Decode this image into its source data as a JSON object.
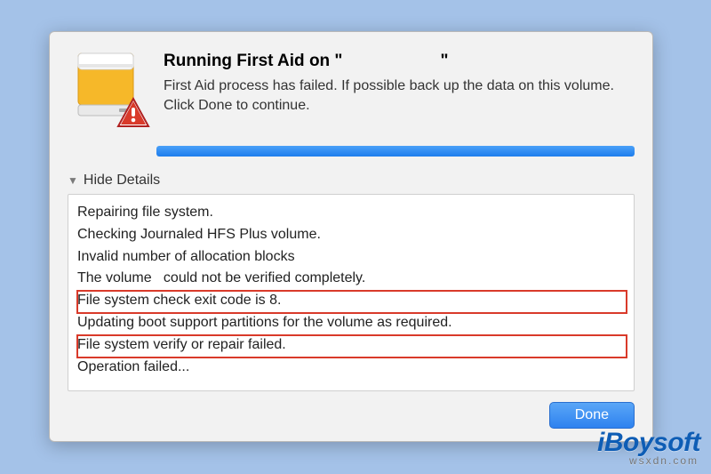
{
  "dialog": {
    "title_prefix": "Running First Aid on \"",
    "title_volume": "",
    "title_suffix": "\"",
    "subtitle": "First Aid process has failed. If possible back up the data on this volume. Click Done to continue.",
    "details_toggle": "Hide Details",
    "done_button": "Done",
    "progress_percent": 100
  },
  "log_lines": [
    "Repairing file system.",
    "Checking Journaled HFS Plus volume.",
    "Invalid number of allocation blocks",
    "The volume   could not be verified completely.",
    "File system check exit code is 8.",
    "Updating boot support partitions for the volume as required.",
    "File system verify or repair failed.",
    "Operation failed..."
  ],
  "highlights": [
    4,
    6
  ],
  "icons": {
    "disk": "disk-icon",
    "alert": "alert-badge-icon",
    "triangle": "disclosure-triangle-icon"
  },
  "watermark": {
    "brand": "iBoysoft",
    "sub": "wsxdn.com"
  },
  "colors": {
    "bg": "#a4c2e8",
    "accent": "#2e82ef",
    "highlight_border": "#d93a2a"
  }
}
